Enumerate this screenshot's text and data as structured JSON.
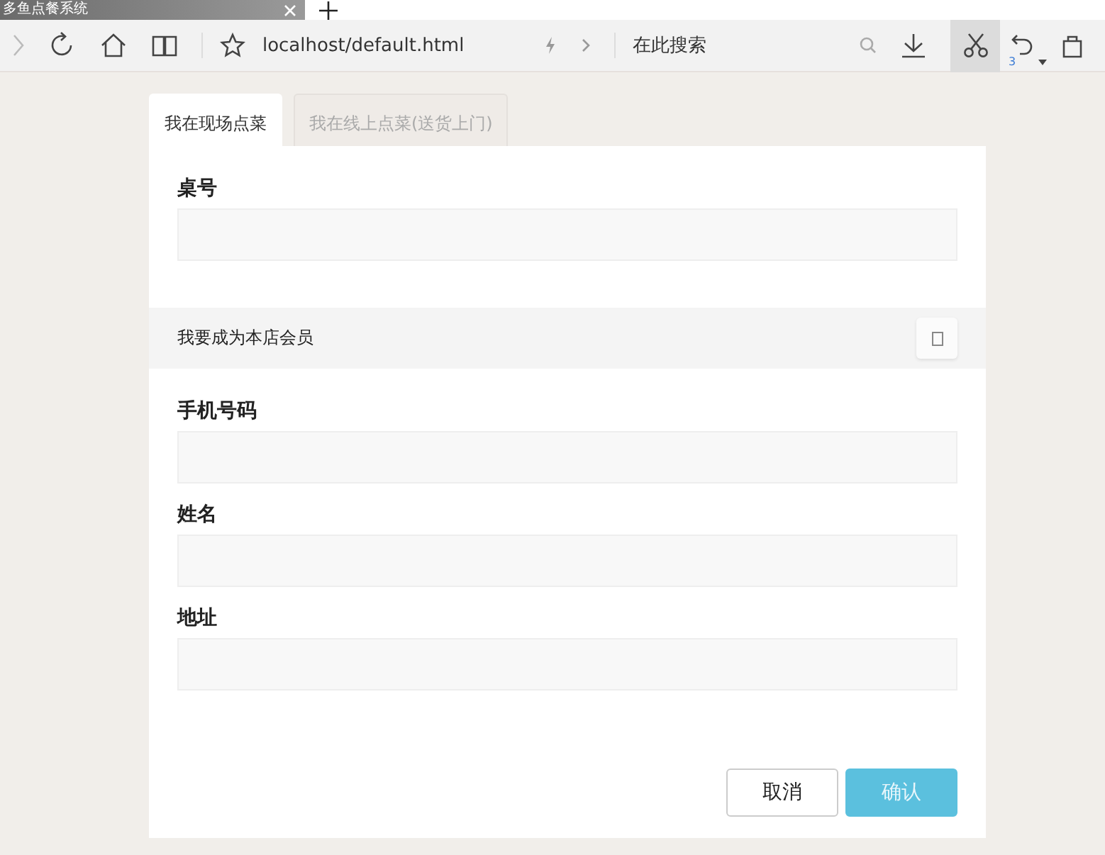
{
  "browser": {
    "tab_title": "多鱼点餐系统",
    "address": "localhost/default.html",
    "search_placeholder": "在此搜索",
    "undo_count": "3"
  },
  "tabs": [
    {
      "label": "我在现场点菜",
      "selected": true
    },
    {
      "label": "我在线上点菜(送货上门)",
      "selected": false
    }
  ],
  "form": {
    "table_field": {
      "label": "桌号"
    },
    "member": {
      "label": "我要成为本店会员",
      "checked": false
    },
    "fields": [
      {
        "label": "手机号码"
      },
      {
        "label": "姓名"
      },
      {
        "label": "地址"
      }
    ],
    "buttons": [
      {
        "label": "取消",
        "kind": "secondary"
      },
      {
        "label": "确认",
        "kind": "primary"
      }
    ]
  }
}
